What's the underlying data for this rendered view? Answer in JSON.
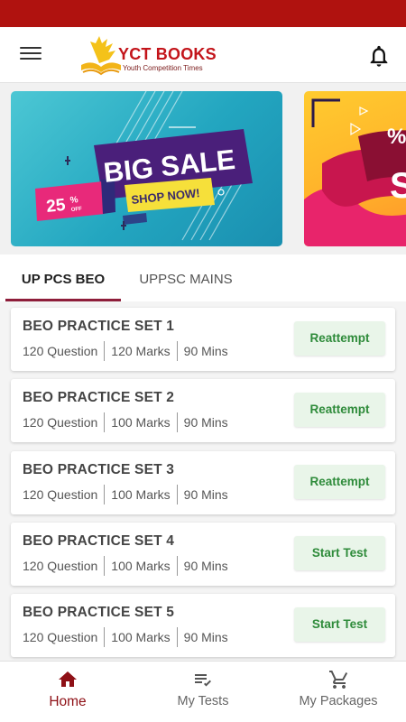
{
  "header": {
    "brand_name": "YCT BOOKS",
    "brand_tagline": "Youth Competition Times",
    "menu_icon": "hamburger-menu-icon",
    "bell_icon": "bell-icon"
  },
  "banners": [
    {
      "title": "BIG SALE",
      "badge_value": "25",
      "badge_unit": "%",
      "badge_off": "OFF",
      "cta": "SHOP NOW!"
    },
    {
      "title": "SA",
      "badge_value": "%"
    }
  ],
  "tabs": [
    {
      "label": "UP PCS BEO",
      "active": true
    },
    {
      "label": "UPPSC MAINS",
      "active": false
    }
  ],
  "tests": [
    {
      "title": "BEO PRACTICE SET 1",
      "questions": "120 Question",
      "marks": "120 Marks",
      "duration": "90 Mins",
      "action": "Reattempt"
    },
    {
      "title": "BEO PRACTICE SET 2",
      "questions": "120 Question",
      "marks": "100 Marks",
      "duration": "90 Mins",
      "action": "Reattempt"
    },
    {
      "title": "BEO PRACTICE SET 3",
      "questions": "120 Question",
      "marks": "100 Marks",
      "duration": "90 Mins",
      "action": "Reattempt"
    },
    {
      "title": "BEO PRACTICE SET 4",
      "questions": "120 Question",
      "marks": "100 Marks",
      "duration": "90 Mins",
      "action": "Start Test"
    },
    {
      "title": "BEO PRACTICE SET 5",
      "questions": "120 Question",
      "marks": "100 Marks",
      "duration": "90 Mins",
      "action": "Start Test"
    }
  ],
  "bottom_nav": [
    {
      "label": "Home",
      "icon": "home-icon",
      "active": true
    },
    {
      "label": "My Tests",
      "icon": "checklist-icon",
      "active": false
    },
    {
      "label": "My Packages",
      "icon": "cart-icon",
      "active": false
    }
  ],
  "colors": {
    "status_bar": "#b0120f",
    "brand_red": "#c3141a",
    "active_nav": "#8e1016",
    "tab_indicator": "#8e1d3a",
    "action_green": "#2e8b3a",
    "action_bg": "#e9f5e9"
  }
}
